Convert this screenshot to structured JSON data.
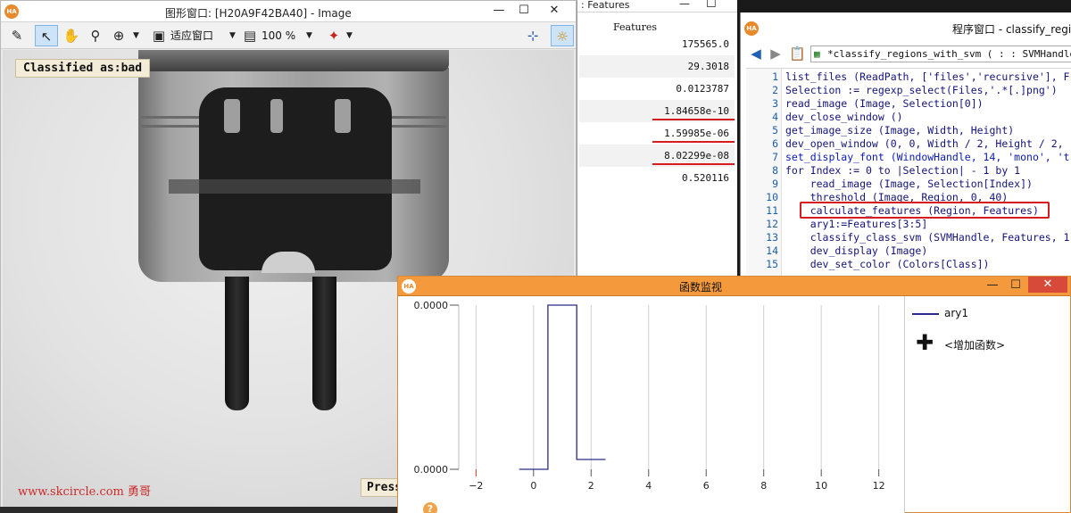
{
  "image_window": {
    "title": "图形窗口: [H20A9F42BA40] - Image",
    "buttons": {
      "minimize": "—",
      "maximize": "☐",
      "close": "✕"
    },
    "toolbar": {
      "zoom_fit_label": "适应窗口",
      "zoom_percent": "100 %"
    },
    "overlay": {
      "classified_label": "Classified as:bad",
      "watermark": "www.skcircle.com 勇哥",
      "press_label": "Press"
    }
  },
  "features_window": {
    "title": ": Features",
    "header": "Features",
    "values": [
      "175565.0",
      "29.3018",
      "0.0123787",
      "1.84658e-10",
      "1.59985e-06",
      "8.02299e-08",
      "0.520116"
    ]
  },
  "program_window": {
    "title": "程序窗口 - classify_regio",
    "procedure_signature": "*classify_regions_with_svm ( : : SVMHandle, C",
    "lines": [
      {
        "n": "1",
        "code": "list_files (ReadPath, ['files','recursive'], F"
      },
      {
        "n": "2",
        "code": "Selection := regexp_select(Files,'.*[.]png')"
      },
      {
        "n": "3",
        "code": "read_image (Image, Selection[0])"
      },
      {
        "n": "4",
        "code": "dev_close_window ()"
      },
      {
        "n": "5",
        "code": "get_image_size (Image, Width, Height)"
      },
      {
        "n": "6",
        "code": "dev_open_window (0, 0, Width / 2, Height / 2,"
      },
      {
        "n": "7",
        "code": "set_display_font (WindowHandle, 14, 'mono', 't"
      },
      {
        "n": "8",
        "code": "for Index := 0 to |Selection| - 1 by 1"
      },
      {
        "n": "9",
        "code": "    read_image (Image, Selection[Index])"
      },
      {
        "n": "10",
        "code": "    threshold (Image, Region, 0, 40)"
      },
      {
        "n": "11",
        "code": "    calculate_features (Region, Features)"
      },
      {
        "n": "12",
        "code": "    ary1:=Features[3:5]"
      },
      {
        "n": "13",
        "code": "    classify_class_svm (SVMHandle, Features, 1"
      },
      {
        "n": "14",
        "code": "    dev_display (Image)"
      },
      {
        "n": "15",
        "code": "    dev_set_color (Colors[Class])"
      }
    ]
  },
  "monitor_window": {
    "title": "函数监视",
    "buttons": {
      "minimize": "—",
      "maximize": "☐",
      "close": "✕"
    },
    "legend_series": "ary1",
    "add_function_label": "<增加函数>",
    "help_glyph": "?"
  },
  "chart_data": {
    "type": "line",
    "x": [
      -0.5,
      0.5,
      0.5,
      1.5,
      1.5,
      2.5
    ],
    "y": [
      0,
      0,
      1,
      1,
      0.06,
      0.06
    ],
    "xlim": [
      -2.6,
      12.6
    ],
    "xticks": [
      -2,
      0,
      2,
      4,
      6,
      8,
      10,
      12
    ],
    "y_tick_labels": [
      "0.0000",
      "0.0000"
    ],
    "series": [
      {
        "name": "ary1",
        "color": "#2b2a8a"
      }
    ],
    "grid": true,
    "legend": "right"
  }
}
